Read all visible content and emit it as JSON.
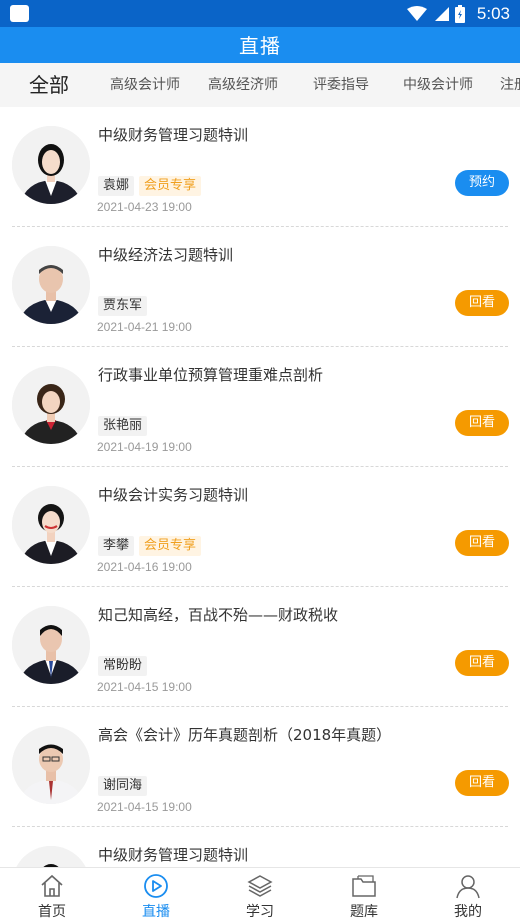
{
  "status_bar": {
    "time": "5:03"
  },
  "header": {
    "title": "直播"
  },
  "categories": [
    "全部",
    "高级会计师",
    "高级经济师",
    "评委指导",
    "中级会计师",
    "注册"
  ],
  "items": [
    {
      "title": "中级财务管理习题特训",
      "teacher": "袁娜",
      "vip_tag": "会员专享",
      "date": "2021-04-23 19:00",
      "button": "预约",
      "button_type": "reserve"
    },
    {
      "title": "中级经济法习题特训",
      "teacher": "贾东军",
      "vip_tag": null,
      "date": "2021-04-21 19:00",
      "button": "回看",
      "button_type": "replay"
    },
    {
      "title": "行政事业单位预算管理重难点剖析",
      "teacher": "张艳丽",
      "vip_tag": null,
      "date": "2021-04-19 19:00",
      "button": "回看",
      "button_type": "replay"
    },
    {
      "title": "中级会计实务习题特训",
      "teacher": "李攀",
      "vip_tag": "会员专享",
      "date": "2021-04-16 19:00",
      "button": "回看",
      "button_type": "replay"
    },
    {
      "title": "知己知高经，百战不殆——财政税收",
      "teacher": "常盼盼",
      "vip_tag": null,
      "date": "2021-04-15 19:00",
      "button": "回看",
      "button_type": "replay"
    },
    {
      "title": "高会《会计》历年真题剖析（2018年真题）",
      "teacher": "谢同海",
      "vip_tag": null,
      "date": "2021-04-15 19:00",
      "button": "回看",
      "button_type": "replay"
    },
    {
      "title": "中级财务管理习题特训",
      "teacher": "",
      "vip_tag": null,
      "date": "",
      "button": "",
      "button_type": ""
    }
  ],
  "tabbar": [
    {
      "label": "首页",
      "icon": "home-icon",
      "active": false
    },
    {
      "label": "直播",
      "icon": "live-play-icon",
      "active": true
    },
    {
      "label": "学习",
      "icon": "layers-icon",
      "active": false
    },
    {
      "label": "题库",
      "icon": "folder-icon",
      "active": false
    },
    {
      "label": "我的",
      "icon": "user-icon",
      "active": false
    }
  ],
  "colors": {
    "primary": "#1a8df0",
    "status_bar": "#0a64c8",
    "replay": "#f59a00",
    "vip_text": "#f0a020"
  }
}
